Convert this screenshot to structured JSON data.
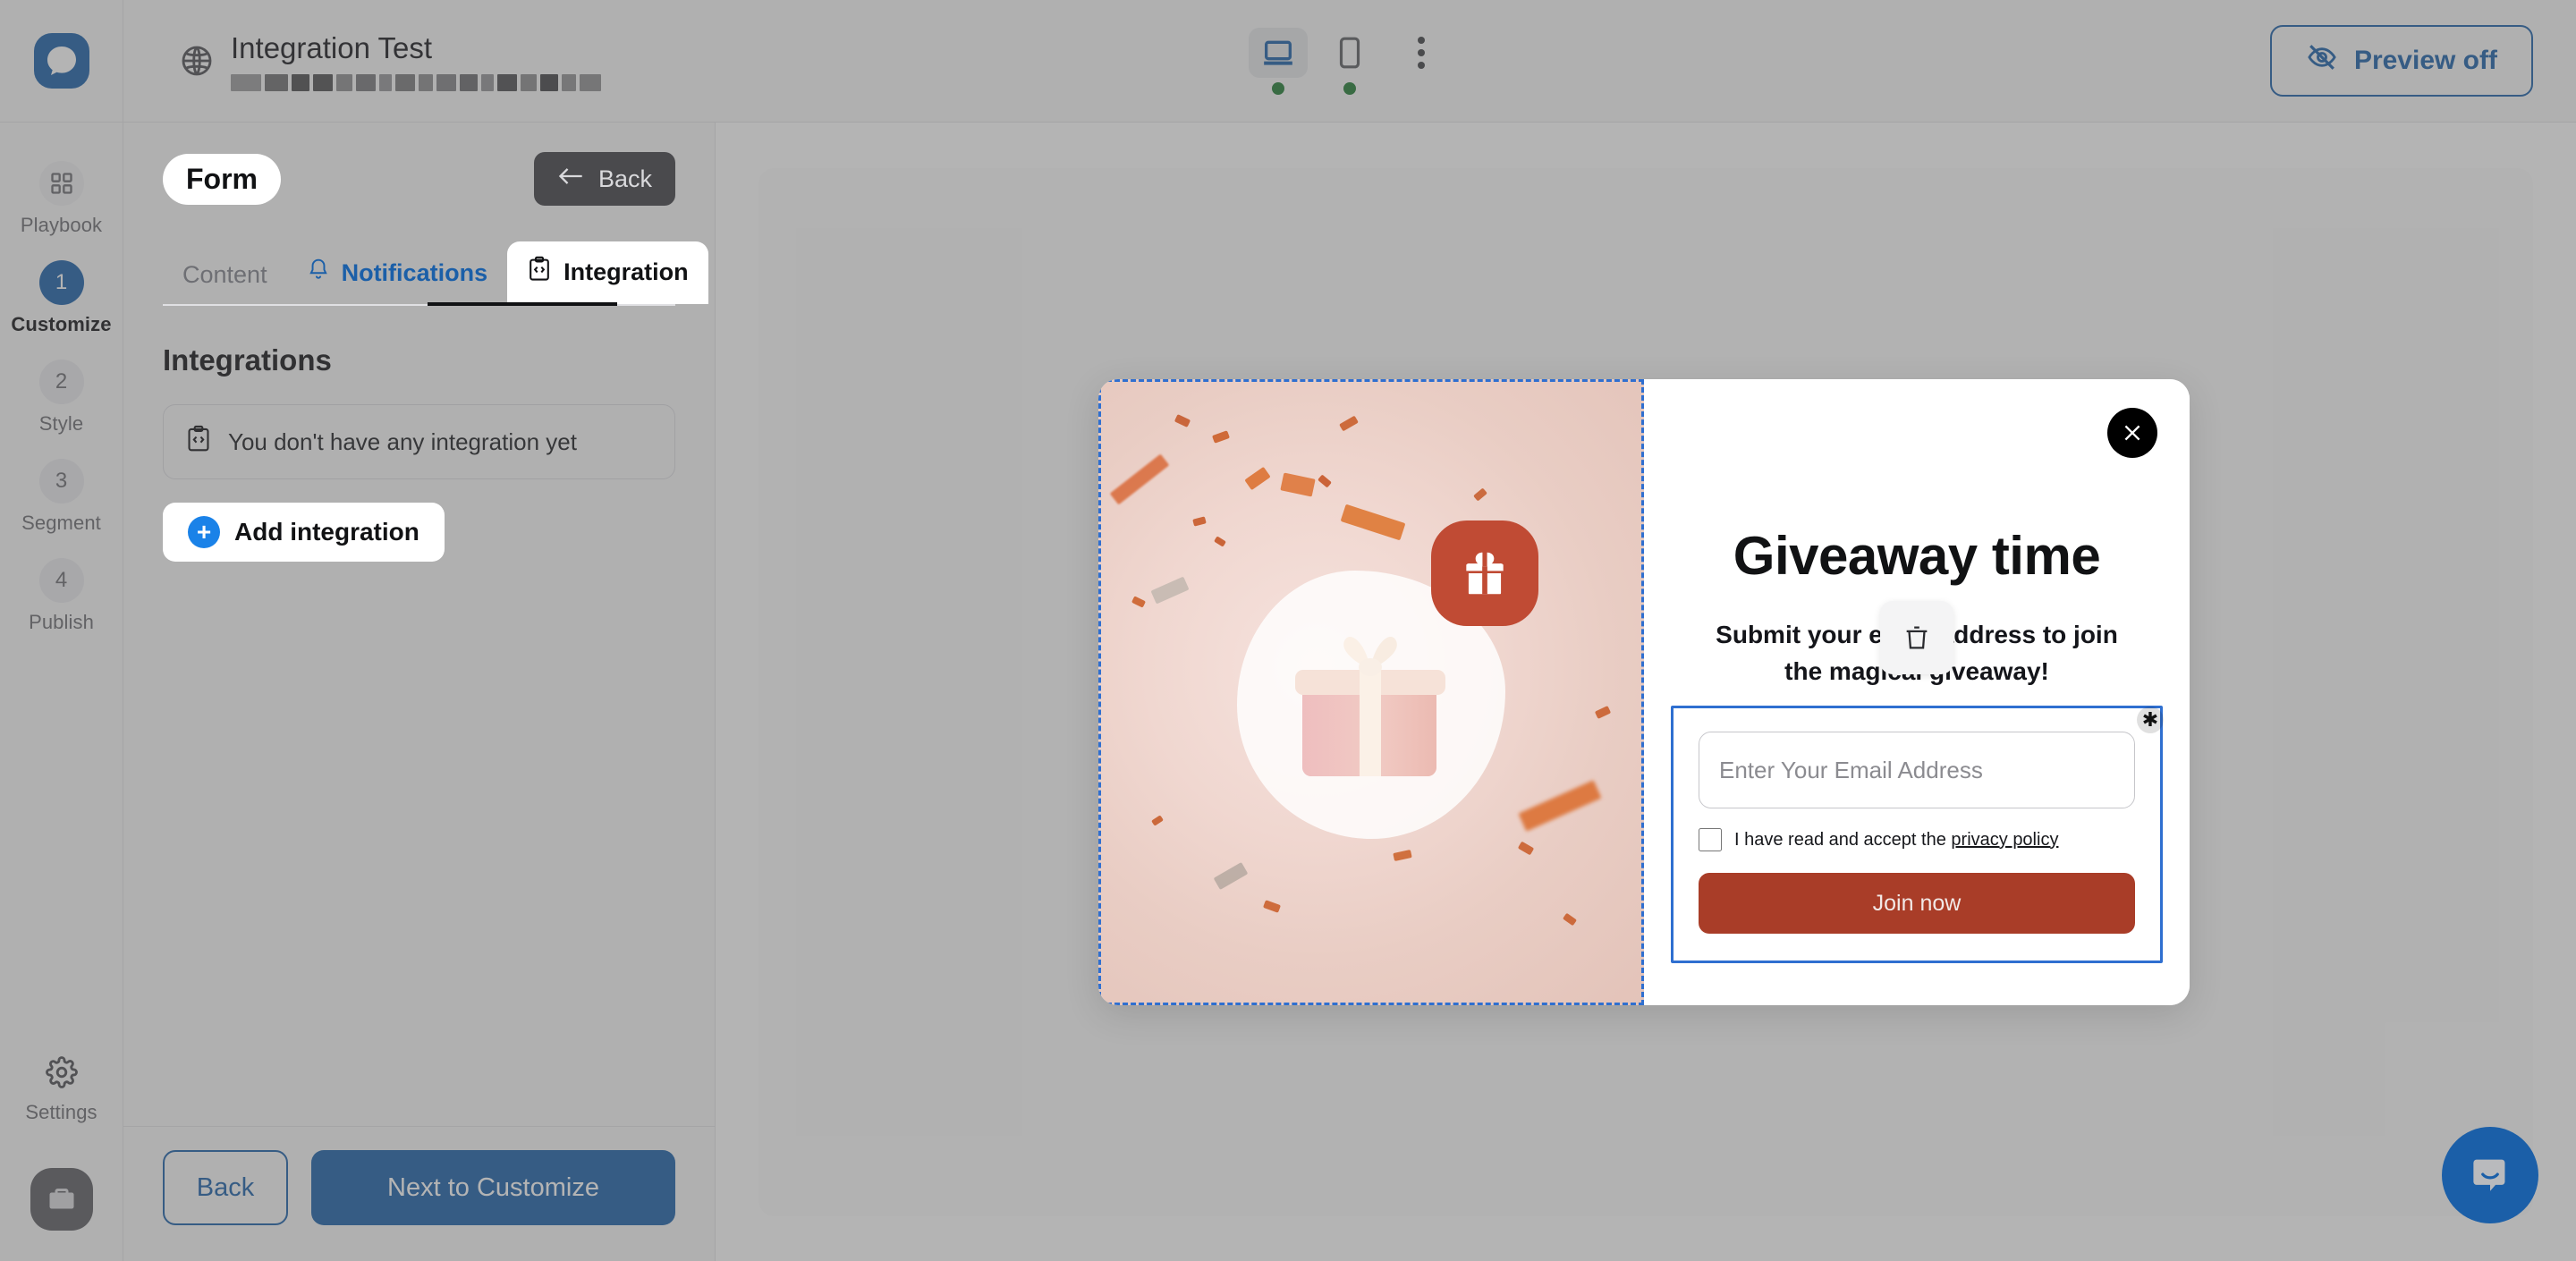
{
  "brand": {
    "accent": "#1b5fa8",
    "accent_light": "#1a82e8",
    "danger": "#a93d28"
  },
  "rail": {
    "logo_icon": "chat-bubble-logo-icon",
    "items": [
      {
        "id": "playbook",
        "badge": "",
        "label": "Playbook",
        "active": false,
        "icon": "grid-icon"
      },
      {
        "id": "customize",
        "badge": "1",
        "label": "Customize",
        "active": true
      },
      {
        "id": "style",
        "badge": "2",
        "label": "Style",
        "active": false
      },
      {
        "id": "segment",
        "badge": "3",
        "label": "Segment",
        "active": false
      },
      {
        "id": "publish",
        "badge": "4",
        "label": "Publish",
        "active": false
      }
    ],
    "settings_label": "Settings",
    "settings_icon": "gear-icon",
    "avatar_icon": "briefcase-icon"
  },
  "topbar": {
    "globe_icon": "globe-icon",
    "title": "Integration Test",
    "redacted_blocks": [
      {
        "w": 34,
        "c": "#9a9a9c"
      },
      {
        "w": 26,
        "c": "#6e6e70"
      },
      {
        "w": 20,
        "c": "#4b4b4d"
      },
      {
        "w": 22,
        "c": "#4f4f51"
      },
      {
        "w": 18,
        "c": "#8c8c8e"
      },
      {
        "w": 22,
        "c": "#77777a"
      },
      {
        "w": 14,
        "c": "#949497"
      },
      {
        "w": 22,
        "c": "#78787b"
      },
      {
        "w": 16,
        "c": "#8b8b8d"
      },
      {
        "w": 22,
        "c": "#828285"
      },
      {
        "w": 20,
        "c": "#6a6a6d"
      },
      {
        "w": 14,
        "c": "#939396"
      },
      {
        "w": 22,
        "c": "#4e4e50"
      },
      {
        "w": 18,
        "c": "#8a8a8d"
      },
      {
        "w": 20,
        "c": "#434345"
      },
      {
        "w": 16,
        "c": "#909093"
      },
      {
        "w": 24,
        "c": "#8e8e91"
      }
    ],
    "devices": [
      {
        "id": "desktop",
        "icon": "desktop-icon",
        "selected": true,
        "status": "online"
      },
      {
        "id": "mobile",
        "icon": "mobile-icon",
        "selected": false,
        "status": "online"
      }
    ],
    "more_icon": "more-vertical-icon",
    "preview_button": {
      "label": "Preview off",
      "icon": "eye-off-icon"
    }
  },
  "panel": {
    "type_pill": "Form",
    "back_chip": {
      "label": "Back",
      "icon": "arrow-left-icon"
    },
    "tabs": [
      {
        "id": "content",
        "label": "Content",
        "icon": "",
        "active": false,
        "highlight": false
      },
      {
        "id": "notifications",
        "label": "Notifications",
        "icon": "bell-icon",
        "active": false,
        "highlight": true
      },
      {
        "id": "integration",
        "label": "Integration",
        "icon": "code-clipboard-icon",
        "active": true,
        "highlight": false
      }
    ],
    "section_title": "Integrations",
    "empty_state": {
      "icon": "code-clipboard-icon",
      "text": "You don't have any integration yet"
    },
    "add_button": {
      "label": "Add integration",
      "icon": "plus-circle-icon"
    },
    "footer": {
      "back_label": "Back",
      "next_label": "Next to Customize"
    }
  },
  "popup": {
    "close_icon": "close-icon",
    "image": {
      "alt": "gift-box-confetti-image",
      "badge_icon": "gift-icon"
    },
    "heading": "Giveaway time",
    "subheading": "Submit your email address to join the magical giveaway!",
    "email_input": {
      "placeholder": "Enter Your Email Address",
      "value": ""
    },
    "required_marker": "✱",
    "consent": {
      "prefix": "I have read and accept the ",
      "link": "privacy policy"
    },
    "submit_label": "Join now",
    "toolbar": {
      "delete_icon": "trash-icon"
    }
  },
  "chat": {
    "icon": "chat-bubble-icon"
  }
}
